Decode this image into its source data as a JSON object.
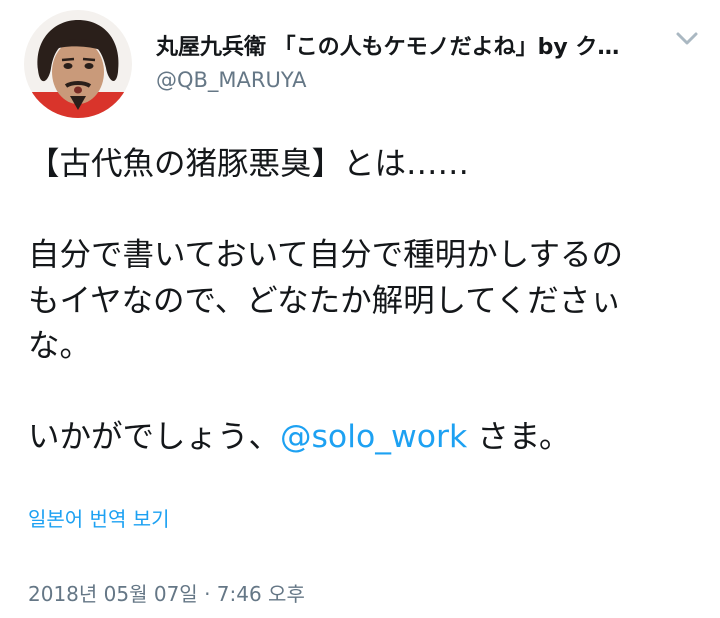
{
  "author": {
    "display_name": "丸屋九兵衛 「この人もケモノだよね」by ク…",
    "handle": "@QB_MARUYA",
    "avatar_icon": "profile-photo"
  },
  "header": {
    "menu_icon": "chevron-down-icon"
  },
  "tweet": {
    "line1": "【古代魚の猪豚悪臭】とは……",
    "line2": "自分で書いておいて自分で種明かしするの",
    "line3": "もイヤなので、どなたか解明してくださぃ",
    "line4": "な。",
    "line5_prefix": "いかがでしょう、",
    "mention": "@solo_work",
    "line5_suffix": " さま。"
  },
  "translate_label": "일본어 번역 보기",
  "timestamp": "2018년 05월 07일 · 7:46 오후",
  "colors": {
    "link": "#1da1f2",
    "secondary": "#657786",
    "text": "#14171a"
  }
}
